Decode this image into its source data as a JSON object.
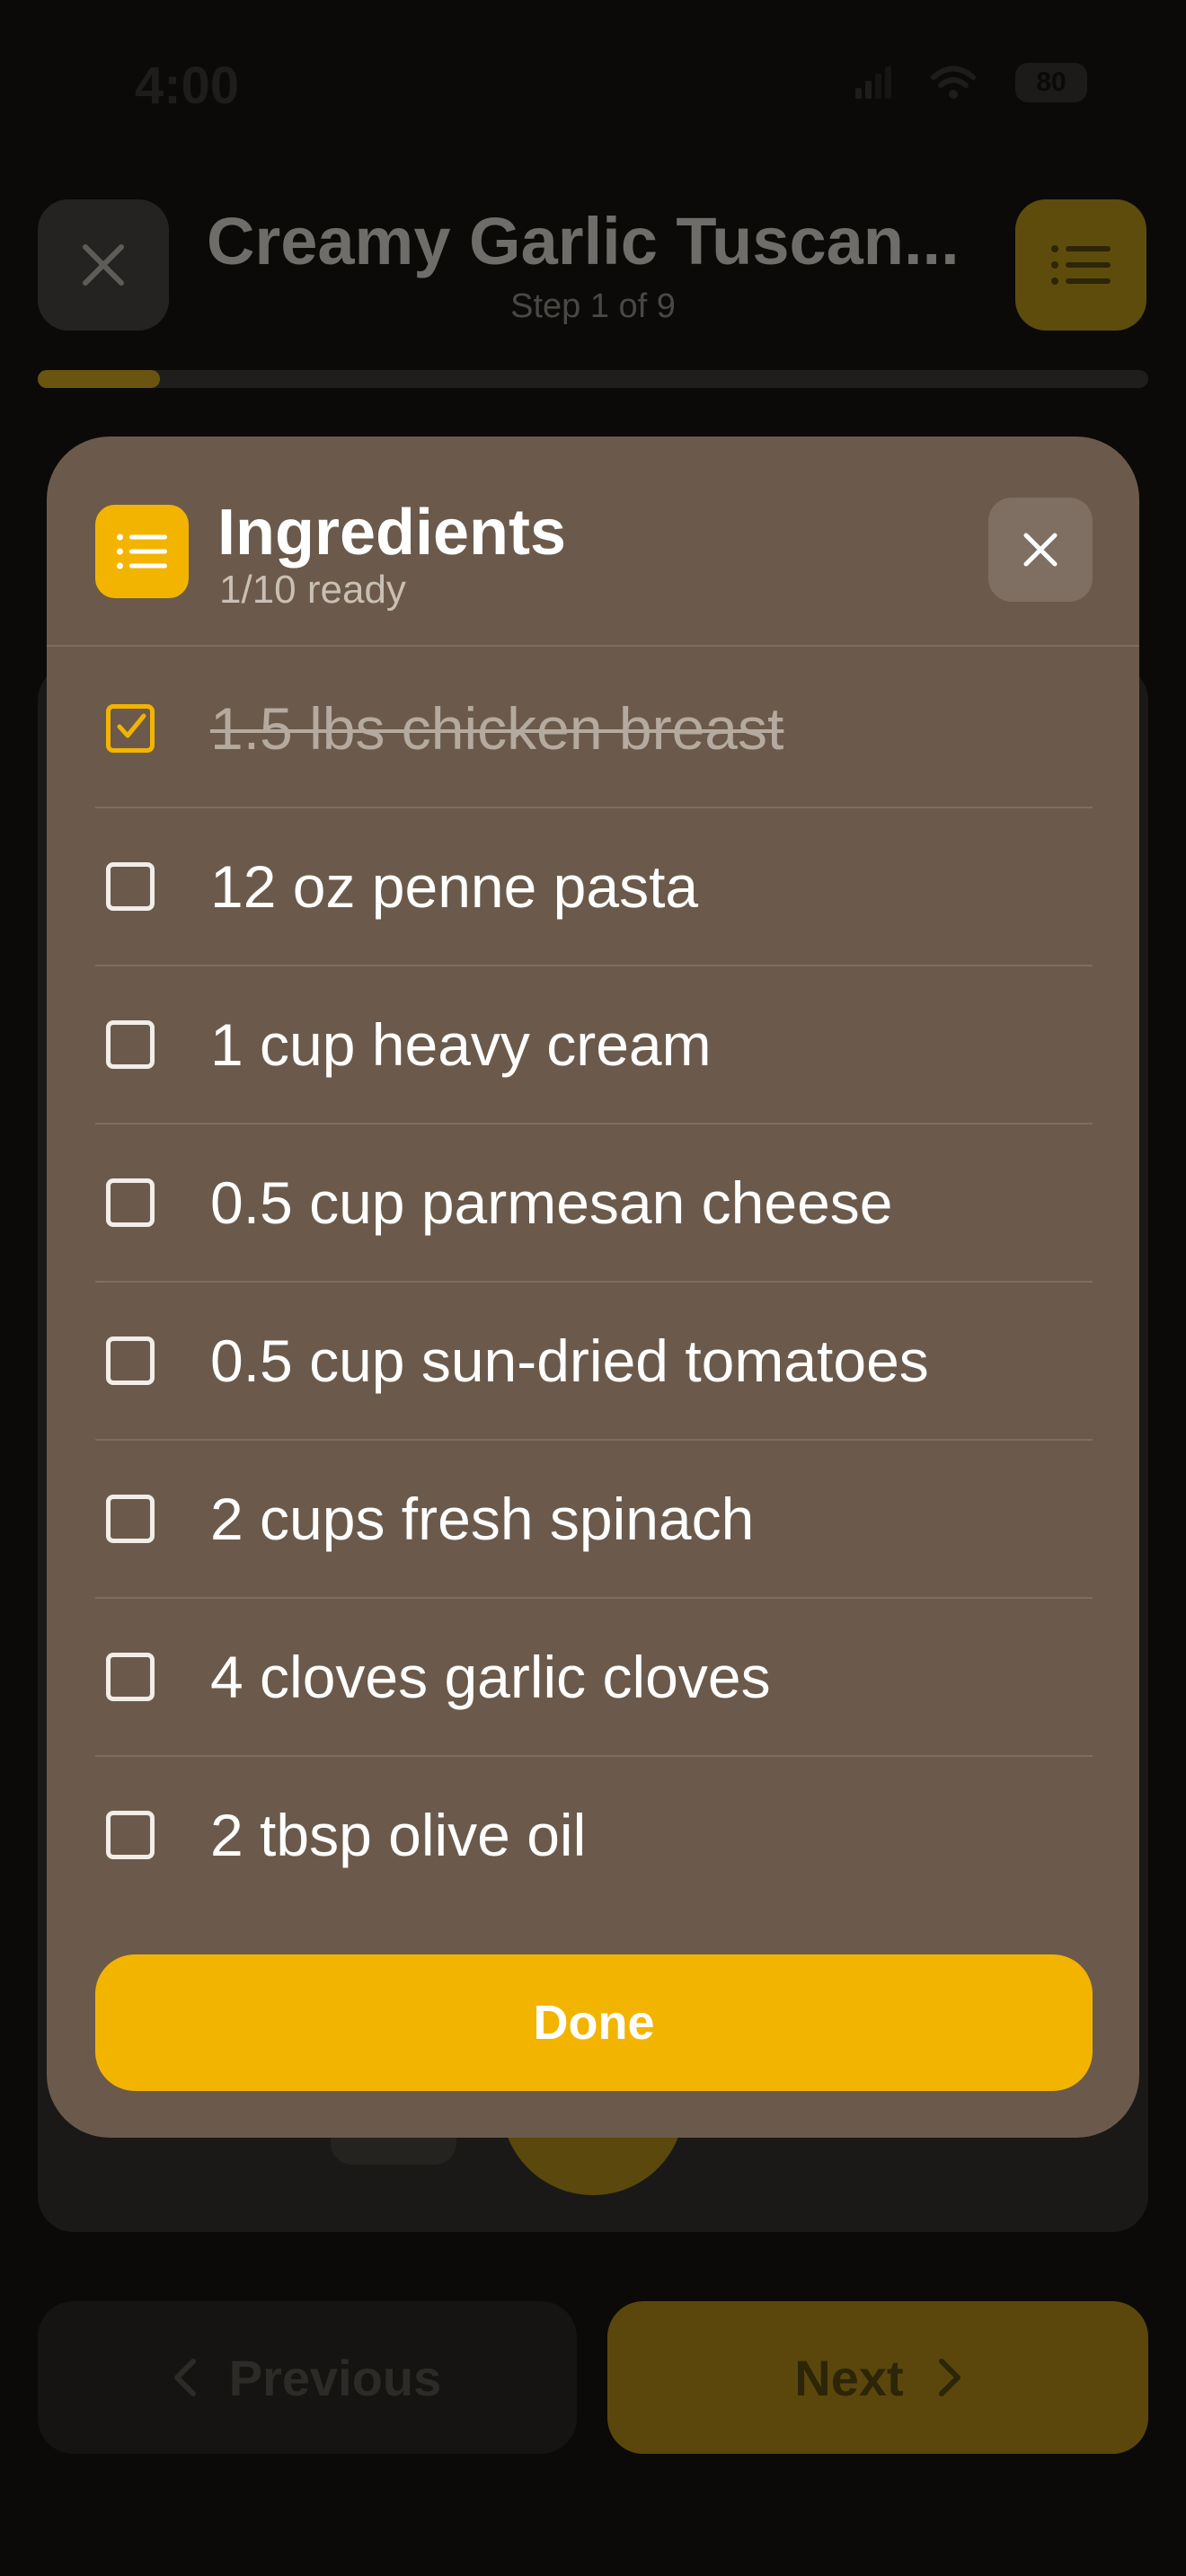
{
  "status_bar": {
    "time": "4:00",
    "battery": "80"
  },
  "header": {
    "title": "Creamy Garlic Tuscan...",
    "step_label": "Step 1 of 9",
    "progress": 0.11
  },
  "footer": {
    "previous_label": "Previous",
    "next_label": "Next"
  },
  "modal": {
    "title": "Ingredients",
    "subtitle": "1/10 ready",
    "done_label": "Done",
    "items": [
      {
        "label": "1.5 lbs chicken breast",
        "checked": true
      },
      {
        "label": "12 oz penne pasta",
        "checked": false
      },
      {
        "label": "1 cup heavy cream",
        "checked": false
      },
      {
        "label": "0.5 cup parmesan cheese",
        "checked": false
      },
      {
        "label": "0.5 cup sun-dried tomatoes",
        "checked": false
      },
      {
        "label": "2 cups fresh spinach",
        "checked": false
      },
      {
        "label": "4 cloves garlic cloves",
        "checked": false
      },
      {
        "label": "2 tbsp olive oil",
        "checked": false
      }
    ]
  },
  "colors": {
    "accent": "#f3b400",
    "modal_bg": "#6b5a4b"
  }
}
